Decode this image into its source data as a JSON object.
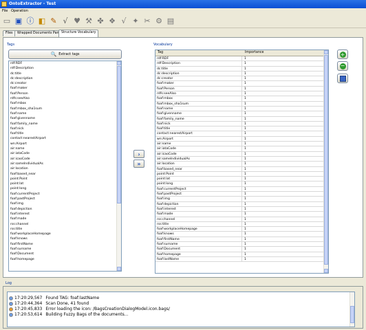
{
  "window": {
    "title": "OntoExtractor - Test"
  },
  "menu": {
    "file": "File",
    "operation": "Operation"
  },
  "tabs": [
    {
      "label": "Files"
    },
    {
      "label": "Wrapped Documents Panel"
    },
    {
      "label": "Structure Vocabulary"
    }
  ],
  "tags_panel": {
    "title": "Tags",
    "extract_label": "Extract tags",
    "items": [
      "rdf:RDF",
      "rdf:Description",
      "dc:title",
      "dc:description",
      "dc:creator",
      "foaf:maker",
      "foaf:Person",
      "rdfs:seeAlso",
      "foaf:mbox",
      "foaf:mbox_sha1sum",
      "foaf:name",
      "foaf:givenname",
      "foaf:family_name",
      "foaf:nick",
      "foaf:title",
      "contact:nearestAirport",
      "wn:Airport",
      "air:name",
      "air:iataCode",
      "air:icaoCode",
      "air:sameIndividualAs",
      "air:location",
      "foaf:based_near",
      "point:Point",
      "point:lat",
      "point:long",
      "foaf:currentProject",
      "foaf:pastProject",
      "foaf:img",
      "foaf:depiction",
      "foaf:interest",
      "foaf:made",
      "rss:channel",
      "rss:title",
      "foaf:workplaceHomepage",
      "foaf:knows",
      "foaf:firstName",
      "foaf:surname",
      "foaf:Document",
      "foaf:homepage"
    ]
  },
  "vocabulary_panel": {
    "title": "Vocabulary",
    "col_tag": "Tag",
    "col_importance": "Importance",
    "rows": [
      {
        "tag": "rdf:RDF",
        "importance": "1"
      },
      {
        "tag": "rdf:Description",
        "importance": "1"
      },
      {
        "tag": "dc:title",
        "importance": "1"
      },
      {
        "tag": "dc:description",
        "importance": "1"
      },
      {
        "tag": "dc:creator",
        "importance": "1"
      },
      {
        "tag": "foaf:maker",
        "importance": "1"
      },
      {
        "tag": "foaf:Person",
        "importance": "1"
      },
      {
        "tag": "rdfs:seeAlso",
        "importance": "1"
      },
      {
        "tag": "foaf:mbox",
        "importance": "1"
      },
      {
        "tag": "foaf:mbox_sha1sum",
        "importance": "1"
      },
      {
        "tag": "foaf:name",
        "importance": "1"
      },
      {
        "tag": "foaf:givenname",
        "importance": "1"
      },
      {
        "tag": "foaf:family_name",
        "importance": "1"
      },
      {
        "tag": "foaf:nick",
        "importance": "1"
      },
      {
        "tag": "foaf:title",
        "importance": "1"
      },
      {
        "tag": "contact:nearestAirport",
        "importance": "1"
      },
      {
        "tag": "wn:Airport",
        "importance": "1"
      },
      {
        "tag": "air:name",
        "importance": "1"
      },
      {
        "tag": "air:iataCode",
        "importance": "1"
      },
      {
        "tag": "air:icaoCode",
        "importance": "1"
      },
      {
        "tag": "air:sameIndividualAs",
        "importance": "1"
      },
      {
        "tag": "air:location",
        "importance": "1"
      },
      {
        "tag": "foaf:based_near",
        "importance": "1"
      },
      {
        "tag": "point:Point",
        "importance": "1"
      },
      {
        "tag": "point:lat",
        "importance": "1"
      },
      {
        "tag": "point:long",
        "importance": "1"
      },
      {
        "tag": "foaf:currentProject",
        "importance": "1"
      },
      {
        "tag": "foaf:pastProject",
        "importance": "1"
      },
      {
        "tag": "foaf:img",
        "importance": "1"
      },
      {
        "tag": "foaf:depiction",
        "importance": "1"
      },
      {
        "tag": "foaf:interest",
        "importance": "1"
      },
      {
        "tag": "foaf:made",
        "importance": "1"
      },
      {
        "tag": "rss:channel",
        "importance": "1"
      },
      {
        "tag": "rss:title",
        "importance": "1"
      },
      {
        "tag": "foaf:workplaceHomepage",
        "importance": "1"
      },
      {
        "tag": "foaf:knows",
        "importance": "1"
      },
      {
        "tag": "foaf:firstName",
        "importance": "1"
      },
      {
        "tag": "foaf:surname",
        "importance": "1"
      },
      {
        "tag": "foaf:Document",
        "importance": "1"
      },
      {
        "tag": "foaf:homepage",
        "importance": "1"
      },
      {
        "tag": "foaf:lastName",
        "importance": "1"
      }
    ]
  },
  "log": {
    "title": "Log",
    "entries": [
      {
        "time": "17:20:29,567",
        "message": "Found TAG: foaf:lastName",
        "icon": "info-icon"
      },
      {
        "time": "17:20:44,364",
        "message": "Scan Done, 41 found",
        "icon": "info-icon"
      },
      {
        "time": "17:20:45,833",
        "message": "Error loading the icon: /BagsCreationDialogModel.icon.bags/",
        "icon": "error-icon"
      },
      {
        "time": "17:20:53,614",
        "message": "Building Fuzzy Bags of the documents...",
        "icon": "info-icon"
      }
    ]
  },
  "colors": {
    "titlebar": "#0a4fd4",
    "panel": "#ece9d8",
    "accent": "#1f4fbf",
    "add": "#2e9a2e"
  }
}
